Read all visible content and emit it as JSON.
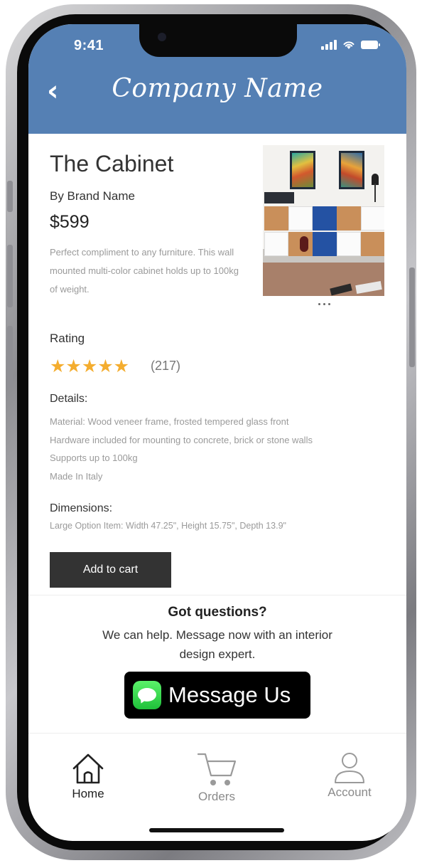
{
  "status_bar": {
    "time": "9:41"
  },
  "header": {
    "title": "Company Name",
    "back_label": "‹"
  },
  "product": {
    "title": "The Cabinet",
    "brand": "By Brand Name",
    "price": "$599",
    "description": "Perfect compliment to any furniture. This wall mounted multi-color cabinet holds up to 100kg of weight."
  },
  "rating": {
    "label": "Rating",
    "stars": "★★★★★",
    "value": 5,
    "count": "(217)"
  },
  "details": {
    "label": "Details:",
    "items": [
      "Material: Wood veneer frame, frosted tempered glass front",
      "Hardware included for mounting to concrete, brick or stone walls",
      "Supports up to 100kg",
      "Made In Italy"
    ]
  },
  "dimensions": {
    "label": "Dimensions:",
    "text": "Large Option Item: Width 47.25\", Height 15.75\", Depth 13.9\""
  },
  "cart": {
    "button_label": "Add to cart"
  },
  "questions": {
    "title": "Got questions?",
    "text": "We can help. Message now with an interior design expert.",
    "message_button": "Message Us"
  },
  "tabbar": {
    "items": [
      {
        "label": "Home",
        "icon": "home-icon",
        "active": true
      },
      {
        "label": "Orders",
        "icon": "cart-icon",
        "active": false
      },
      {
        "label": "Account",
        "icon": "user-icon",
        "active": false
      }
    ]
  },
  "colors": {
    "header": "#5580b4",
    "star": "#f4ad2f",
    "button": "#333333",
    "message_green": "#1fc13a"
  }
}
